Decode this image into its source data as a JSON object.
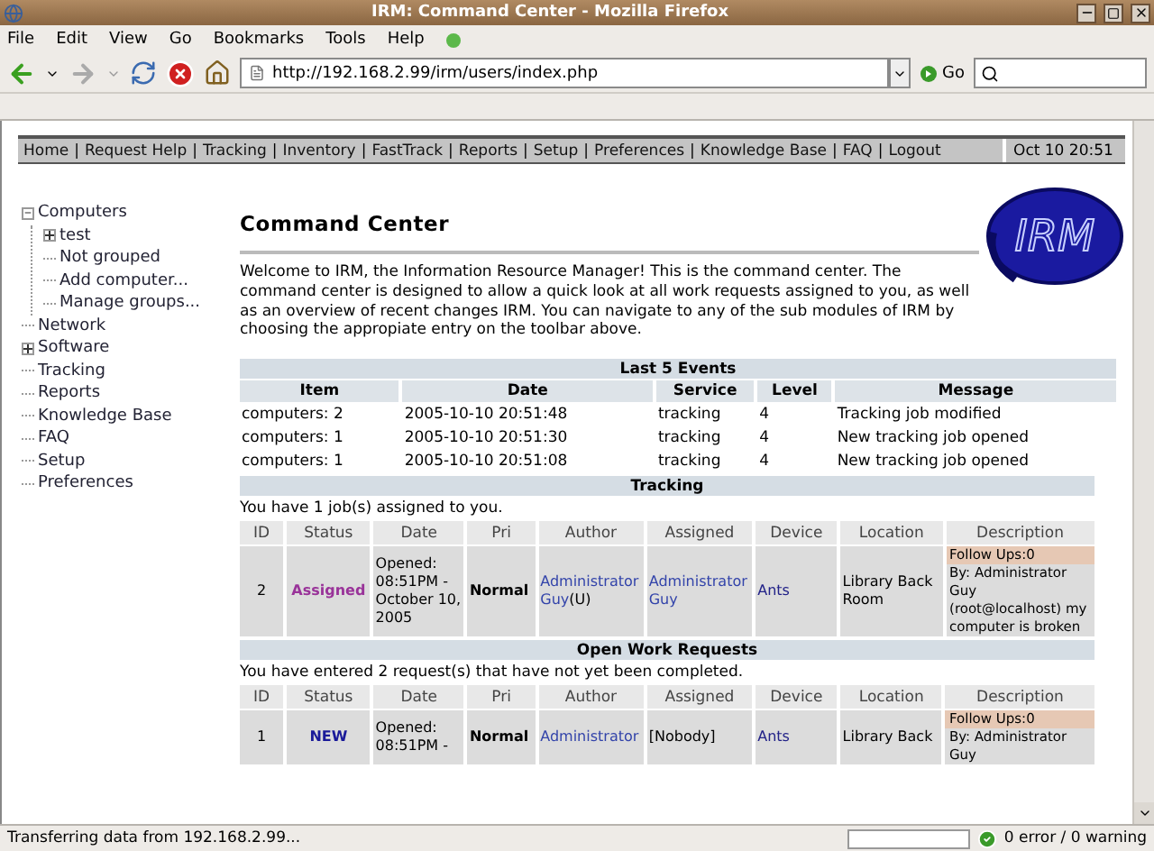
{
  "window": {
    "title": "IRM: Command Center - Mozilla Firefox"
  },
  "menu": [
    "File",
    "Edit",
    "View",
    "Go",
    "Bookmarks",
    "Tools",
    "Help"
  ],
  "toolbar": {
    "url": "http://192.168.2.99/irm/users/index.php",
    "go_label": "Go"
  },
  "nav": {
    "separator": "|",
    "items": [
      "Home",
      "Request Help",
      "Tracking",
      "Inventory",
      "FastTrack",
      "Reports",
      "Setup",
      "Preferences",
      "Knowledge Base",
      "FAQ",
      "Logout"
    ],
    "date": "Oct 10 20:51"
  },
  "sidebar": [
    {
      "label": "Computers",
      "kind": "group",
      "expanded": true,
      "children": [
        {
          "label": "test",
          "kind": "group",
          "expanded": false
        },
        {
          "label": "Not grouped",
          "kind": "link"
        },
        {
          "label": "Add computer...",
          "kind": "link"
        },
        {
          "label": "Manage groups...",
          "kind": "link"
        }
      ]
    },
    {
      "label": "Network",
      "kind": "link"
    },
    {
      "label": "Software",
      "kind": "group",
      "expanded": false
    },
    {
      "label": "Tracking",
      "kind": "link"
    },
    {
      "label": "Reports",
      "kind": "link"
    },
    {
      "label": "Knowledge Base",
      "kind": "link"
    },
    {
      "label": "FAQ",
      "kind": "link"
    },
    {
      "label": "Setup",
      "kind": "link"
    },
    {
      "label": "Preferences",
      "kind": "link"
    }
  ],
  "page": {
    "title": "Command Center",
    "logo": "IRM",
    "intro": "Welcome to IRM, the Information Resource Manager! This is the command center. The command center is designed to allow a quick look at all work requests assigned to you, as well as an overview of recent changes IRM. You can navigate to any of the sub modules of IRM by choosing the appropiate entry on the toolbar above.",
    "events": {
      "title": "Last 5 Events",
      "columns": [
        "Item",
        "Date",
        "Service",
        "Level",
        "Message"
      ],
      "rows": [
        [
          "computers: 2",
          "2005-10-10 20:51:48",
          "tracking",
          "4",
          "Tracking job modified"
        ],
        [
          "computers: 1",
          "2005-10-10 20:51:30",
          "tracking",
          "4",
          "New tracking job opened"
        ],
        [
          "computers: 1",
          "2005-10-10 20:51:08",
          "tracking",
          "4",
          "New tracking job opened"
        ]
      ]
    },
    "sections": [
      {
        "title": "Tracking",
        "note": "You have 1 job(s) assigned to you.",
        "columns": [
          "ID",
          "Status",
          "Date",
          "Pri",
          "Author",
          "Assigned",
          "Device",
          "Location",
          "Description"
        ],
        "jobs": [
          {
            "id": "2",
            "status": "Assigned",
            "color": "#993399",
            "date": [
              "Opened:",
              "08:51PM -",
              "October 10,",
              "2005"
            ],
            "pri": "Normal",
            "author": {
              "link": "Administrator Guy",
              "suffix": "(U)"
            },
            "assigned": {
              "kind": "link",
              "text": "Administrator Guy"
            },
            "device": "Ants",
            "location": "Library Back Room",
            "description": {
              "head": "Follow Ups:0",
              "body": "By: Administrator Guy (root@localhost) my computer is broken"
            }
          }
        ]
      },
      {
        "title": "Open Work Requests",
        "note": "You have entered 2 request(s) that have not yet been completed.",
        "columns": [
          "ID",
          "Status",
          "Date",
          "Pri",
          "Author",
          "Assigned",
          "Device",
          "Location",
          "Description"
        ],
        "jobs": [
          {
            "id": "1",
            "status": "NEW",
            "color": "#1a1a99",
            "date": [
              "Opened:",
              "08:51PM -"
            ],
            "pri": "Normal",
            "author": {
              "link": "Administrator"
            },
            "assigned": {
              "kind": "plain",
              "text": "[Nobody]"
            },
            "device": "Ants",
            "location": "Library Back",
            "description": {
              "head": "Follow Ups:0",
              "body": "By: Administrator Guy"
            }
          }
        ]
      }
    ]
  },
  "status_bar": {
    "text": "Transferring data from 192.168.2.99...",
    "progress": {
      "level": 0
    },
    "summary": "0 error / 0 warning"
  }
}
